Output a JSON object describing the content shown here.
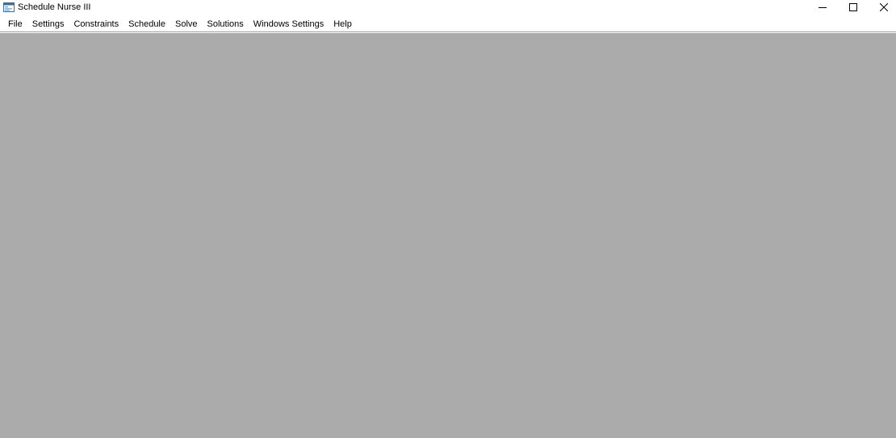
{
  "window": {
    "title": "Schedule Nurse III",
    "icon": "app-window-icon",
    "controls": {
      "minimize_icon": "minimize-icon",
      "maximize_icon": "maximize-icon",
      "close_icon": "close-icon"
    }
  },
  "menubar": {
    "items": [
      {
        "label": "File"
      },
      {
        "label": "Settings"
      },
      {
        "label": "Constraints"
      },
      {
        "label": "Schedule"
      },
      {
        "label": "Solve"
      },
      {
        "label": "Solutions"
      },
      {
        "label": "Windows Settings"
      },
      {
        "label": "Help"
      }
    ]
  },
  "colors": {
    "workspace_background": "#ababab",
    "titlebar_background": "#ffffff",
    "menubar_background": "#ffffff"
  }
}
